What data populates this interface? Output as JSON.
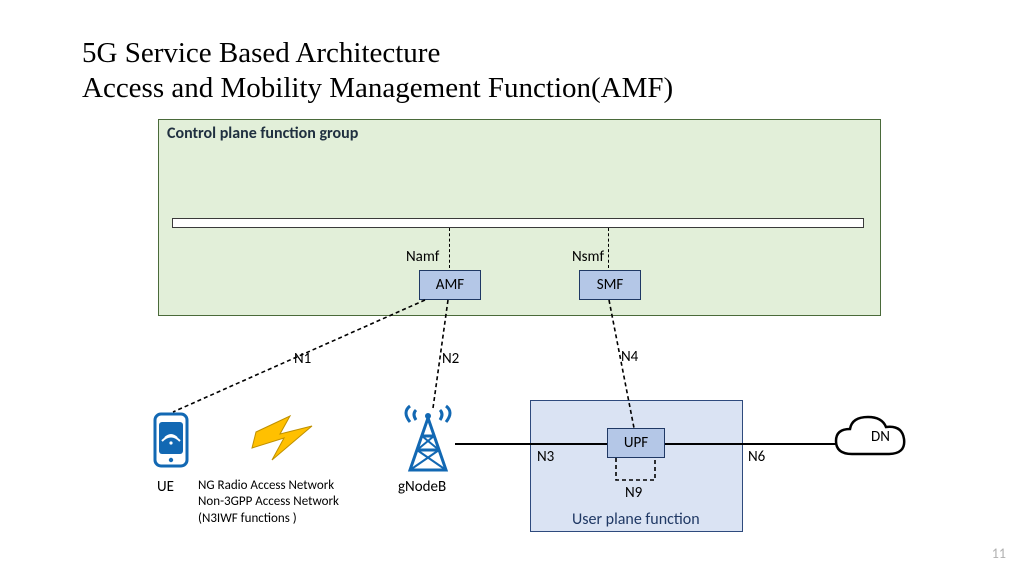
{
  "title_line1": "5G Service Based Architecture",
  "title_line2": "Access and Mobility Management Function(AMF)",
  "control_plane_label": "Control plane function group",
  "user_plane_label": "User plane function",
  "nf": {
    "amf": "AMF",
    "smf": "SMF",
    "upf": "UPF",
    "dn": "DN"
  },
  "iface": {
    "namf": "Namf",
    "nsmf": "Nsmf",
    "n1": "N1",
    "n2": "N2",
    "n3": "N3",
    "n4": "N4",
    "n6": "N6",
    "n9": "N9"
  },
  "labels": {
    "ue": "UE",
    "gnb": "gNodeB"
  },
  "ran_text_line1": "NG Radio Access Network",
  "ran_text_line2": "Non-3GPP Access Network",
  "ran_text_line3": "(N3IWF functions )",
  "page_number": "11",
  "colors": {
    "cp_bg": "#e2efd9",
    "up_bg": "#dae3f3",
    "nf_bg": "#b4c7e7",
    "accent_blue": "#1268b3",
    "lightning": "#ffc000"
  }
}
